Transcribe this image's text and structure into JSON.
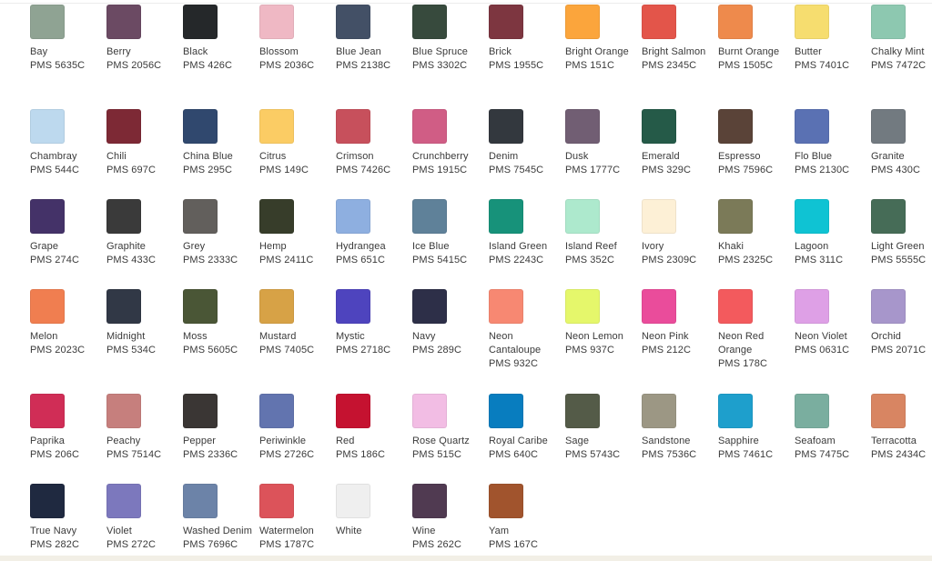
{
  "colors": [
    {
      "name": "Bay",
      "pms": "PMS 5635C",
      "hex": "#8fa393"
    },
    {
      "name": "Berry",
      "pms": "PMS 2056C",
      "hex": "#6b4a63"
    },
    {
      "name": "Black",
      "pms": "PMS 426C",
      "hex": "#25282a"
    },
    {
      "name": "Blossom",
      "pms": "PMS 2036C",
      "hex": "#efb8c4"
    },
    {
      "name": "Blue Jean",
      "pms": "PMS 2138C",
      "hex": "#435066"
    },
    {
      "name": "Blue Spruce",
      "pms": "PMS 3302C",
      "hex": "#374a3d"
    },
    {
      "name": "Brick",
      "pms": "PMS 1955C",
      "hex": "#7d3640"
    },
    {
      "name": "Bright Orange",
      "pms": "PMS 151C",
      "hex": "#fba53c"
    },
    {
      "name": "Bright Salmon",
      "pms": "PMS 2345C",
      "hex": "#e3554a"
    },
    {
      "name": "Burnt Orange",
      "pms": "PMS 1505C",
      "hex": "#ee8a4c"
    },
    {
      "name": "Butter",
      "pms": "PMS 7401C",
      "hex": "#f6dd6f"
    },
    {
      "name": "Chalky Mint",
      "pms": "PMS 7472C",
      "hex": "#8dc8b0"
    },
    {
      "name": "Chambray",
      "pms": "PMS 544C",
      "hex": "#bdd9ee"
    },
    {
      "name": "Chili",
      "pms": "PMS 697C",
      "hex": "#7d2935"
    },
    {
      "name": "China Blue",
      "pms": "PMS 295C",
      "hex": "#30486e"
    },
    {
      "name": "Citrus",
      "pms": "PMS 149C",
      "hex": "#fbcc64"
    },
    {
      "name": "Crimson",
      "pms": "PMS 7426C",
      "hex": "#c7505c"
    },
    {
      "name": "Crunchberry",
      "pms": "PMS 1915C",
      "hex": "#d05d85"
    },
    {
      "name": "Denim",
      "pms": "PMS 7545C",
      "hex": "#33383e"
    },
    {
      "name": "Dusk",
      "pms": "PMS 1777C",
      "hex": "#715e73"
    },
    {
      "name": "Emerald",
      "pms": "PMS 329C",
      "hex": "#255a48"
    },
    {
      "name": "Espresso",
      "pms": "PMS 7596C",
      "hex": "#5a4338"
    },
    {
      "name": "Flo Blue",
      "pms": "PMS 2130C",
      "hex": "#5a71b3"
    },
    {
      "name": "Granite",
      "pms": "PMS 430C",
      "hex": "#727a80"
    },
    {
      "name": "Grape",
      "pms": "PMS 274C",
      "hex": "#443268"
    },
    {
      "name": "Graphite",
      "pms": "PMS 433C",
      "hex": "#3a3a3a"
    },
    {
      "name": "Grey",
      "pms": "PMS 2333C",
      "hex": "#625f5c"
    },
    {
      "name": "Hemp",
      "pms": "PMS 2411C",
      "hex": "#373d2a"
    },
    {
      "name": "Hydrangea",
      "pms": "PMS 651C",
      "hex": "#8eafe0"
    },
    {
      "name": "Ice Blue",
      "pms": "PMS 5415C",
      "hex": "#5f8199"
    },
    {
      "name": "Island Green",
      "pms": "PMS 2243C",
      "hex": "#17927a"
    },
    {
      "name": "Island Reef",
      "pms": "PMS 352C",
      "hex": "#ade9cd"
    },
    {
      "name": "Ivory",
      "pms": "PMS 2309C",
      "hex": "#fdf0d6"
    },
    {
      "name": "Khaki",
      "pms": "PMS 2325C",
      "hex": "#7b7a58"
    },
    {
      "name": "Lagoon",
      "pms": "PMS 311C",
      "hex": "#0fc3d3"
    },
    {
      "name": "Light Green",
      "pms": "PMS 5555C",
      "hex": "#466c57"
    },
    {
      "name": "Melon",
      "pms": "PMS 2023C",
      "hex": "#f07e50"
    },
    {
      "name": "Midnight",
      "pms": "PMS 534C",
      "hex": "#313846"
    },
    {
      "name": "Moss",
      "pms": "PMS 5605C",
      "hex": "#4a5636"
    },
    {
      "name": "Mustard",
      "pms": "PMS 7405C",
      "hex": "#d7a246"
    },
    {
      "name": "Mystic",
      "pms": "PMS 2718C",
      "hex": "#4e44be"
    },
    {
      "name": "Navy",
      "pms": "PMS 289C",
      "hex": "#2d2f48"
    },
    {
      "name": "Neon Cantaloupe",
      "pms": "PMS 932C",
      "hex": "#f78872"
    },
    {
      "name": "Neon Lemon",
      "pms": "PMS 937C",
      "hex": "#e5f76b"
    },
    {
      "name": "Neon Pink",
      "pms": "PMS 212C",
      "hex": "#ea4c9b"
    },
    {
      "name": "Neon Red Orange",
      "pms": "PMS 178C",
      "hex": "#f35a5d"
    },
    {
      "name": "Neon Violet",
      "pms": "PMS 0631C",
      "hex": "#dea0e6"
    },
    {
      "name": "Orchid",
      "pms": "PMS 2071C",
      "hex": "#a796cb"
    },
    {
      "name": "Paprika",
      "pms": "PMS 206C",
      "hex": "#d02d56"
    },
    {
      "name": "Peachy",
      "pms": "PMS 7514C",
      "hex": "#c67f7d"
    },
    {
      "name": "Pepper",
      "pms": "PMS 2336C",
      "hex": "#3a3634"
    },
    {
      "name": "Periwinkle",
      "pms": "PMS 2726C",
      "hex": "#6274af"
    },
    {
      "name": "Red",
      "pms": "PMS 186C",
      "hex": "#c51230"
    },
    {
      "name": "Rose Quartz",
      "pms": "PMS 515C",
      "hex": "#f2bde4"
    },
    {
      "name": "Royal Caribe",
      "pms": "PMS 640C",
      "hex": "#087dbf"
    },
    {
      "name": "Sage",
      "pms": "PMS 5743C",
      "hex": "#545b48"
    },
    {
      "name": "Sandstone",
      "pms": "PMS 7536C",
      "hex": "#9c9784"
    },
    {
      "name": "Sapphire",
      "pms": "PMS 7461C",
      "hex": "#1e9fcc"
    },
    {
      "name": "Seafoam",
      "pms": "PMS 7475C",
      "hex": "#7aae9f"
    },
    {
      "name": "Terracotta",
      "pms": "PMS 2434C",
      "hex": "#d88562"
    },
    {
      "name": "True Navy",
      "pms": "PMS 282C",
      "hex": "#1f2940"
    },
    {
      "name": "Violet",
      "pms": "PMS 272C",
      "hex": "#7c78bd"
    },
    {
      "name": "Washed Denim",
      "pms": "PMS 7696C",
      "hex": "#6c83a8"
    },
    {
      "name": "Watermelon",
      "pms": "PMS 1787C",
      "hex": "#dc535a"
    },
    {
      "name": "White",
      "pms": "",
      "hex": "#efefef"
    },
    {
      "name": "Wine",
      "pms": "PMS 262C",
      "hex": "#503a51"
    },
    {
      "name": "Yam",
      "pms": "PMS 167C",
      "hex": "#a1542d"
    }
  ]
}
